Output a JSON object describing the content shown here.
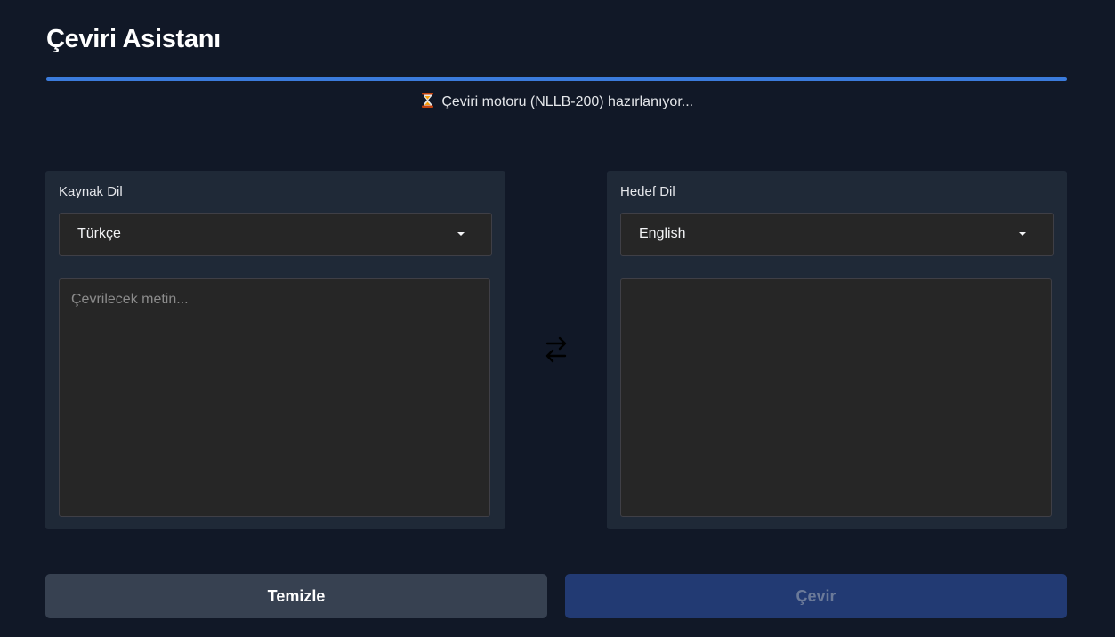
{
  "app": {
    "title": "Çeviri Asistanı"
  },
  "status": {
    "icon": "hourglass-icon",
    "message": "Çeviri motoru (NLLB-200) hazırlanıyor...",
    "progress": 1.0,
    "accent_color": "#3b7bdc"
  },
  "source": {
    "label": "Kaynak Dil",
    "selected_language": "Türkçe",
    "input_value": "",
    "input_placeholder": "Çevrilecek metin..."
  },
  "swap": {
    "icon": "swap-arrows-icon"
  },
  "target": {
    "label": "Hedef Dil",
    "selected_language": "English",
    "output_value": ""
  },
  "actions": {
    "clear_label": "Temizle",
    "translate_label": "Çevir",
    "translate_color": "#223a73",
    "clear_color": "#374151"
  }
}
